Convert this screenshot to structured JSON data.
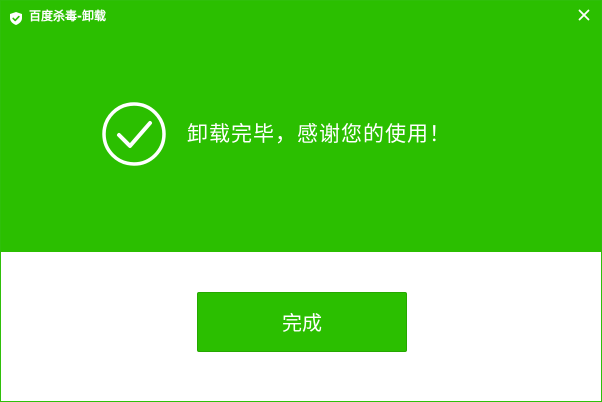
{
  "window": {
    "title": "百度杀毒-卸载",
    "close_icon": "close-icon",
    "app_icon": "shield-icon"
  },
  "status": {
    "icon": "checkmark-circle-icon",
    "message": "卸载完毕，感谢您的使用！"
  },
  "actions": {
    "finish_label": "完成"
  },
  "colors": {
    "brand_green": "#2bbf00",
    "text_on_brand": "#ffffff",
    "body_bg": "#ffffff"
  }
}
